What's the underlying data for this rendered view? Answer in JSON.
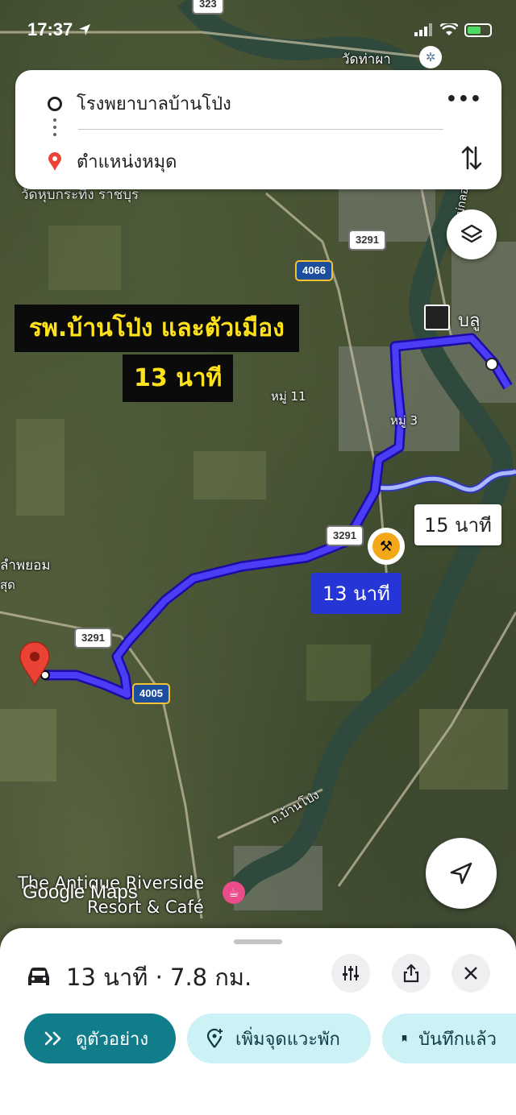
{
  "status_bar": {
    "time": "17:37"
  },
  "route": {
    "origin": "โรงพยาบาลบ้านโป่ง",
    "destination": "ตำแหน่งหมุด",
    "more_label": "•••"
  },
  "map": {
    "overlay_line1": "รพ.บ้านโป่ง และตัวเมือง",
    "overlay_line2": "13 นาที",
    "eta_primary": "13 นาที",
    "eta_alternate": "15 นาที",
    "road_shields": [
      "323",
      "3291",
      "4066",
      "3291",
      "3291",
      "4005"
    ],
    "labels": {
      "temple_top": "วัดท่าผา",
      "temple_left": "วัดหุบกระทิง ราชบุร",
      "moo11": "หมู่ 11",
      "moo3": "หมู่ 3",
      "lampayom": "ลำพยอม",
      "sud": "สุด",
      "blue_place": "บลู",
      "road_banpong": "ถ.บ้านโป่ง",
      "river": "แม่กลอง",
      "antique": "The Antique Riverside",
      "resort": "Resort & Café"
    },
    "attribution": "Google Maps",
    "route_color": "#3b2bf0",
    "alt_route_color": "#a9b8ff"
  },
  "sheet": {
    "summary": "13 นาที · 7.8 กม.",
    "preview_label": "ดูตัวอย่าง",
    "add_stop_label": "เพิ่มจุดแวะพัก",
    "saved_label": "บันทึกแล้ว"
  },
  "colors": {
    "primary_button": "#117d8a",
    "secondary_button": "#ccf2f5",
    "pin": "#ea4335"
  }
}
